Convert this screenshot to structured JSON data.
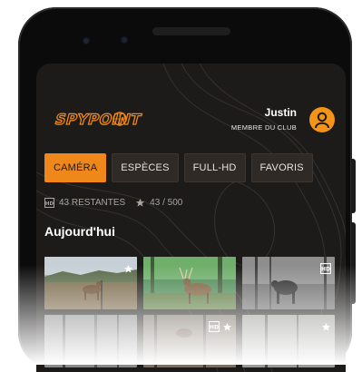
{
  "header": {
    "brand_logo_text": "SPYPOINT",
    "user_name": "Justin",
    "membership": "MEMBRE DU CLUB"
  },
  "tabs": [
    {
      "label": "CAMÉRA",
      "active": true
    },
    {
      "label": "ESPÈCES",
      "active": false
    },
    {
      "label": "FULL-HD",
      "active": false
    },
    {
      "label": "FAVORIS",
      "active": false
    }
  ],
  "stats": {
    "hd_remaining": "43 RESTANTES",
    "favorites": "43 / 500"
  },
  "section_title": "Aujourd'hui",
  "photos": [
    {
      "subject": "deer in field",
      "badge": "star-icon"
    },
    {
      "subject": "buck in forest",
      "badge": ""
    },
    {
      "subject": "moose in black and white",
      "badge": "hd-icon"
    },
    {
      "subject": "forest night",
      "badge": ""
    },
    {
      "subject": "deer in woods",
      "badge": "hd-icon star-icon"
    },
    {
      "subject": "snowy forest",
      "badge": "star-icon"
    }
  ],
  "colors": {
    "accent": "#f0871a",
    "background": "#1d1b19",
    "tab": "#2f2a25",
    "avatar": "#f39317"
  }
}
